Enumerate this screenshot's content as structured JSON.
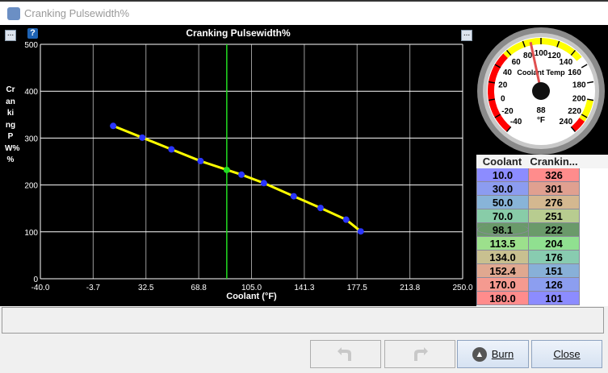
{
  "window": {
    "title": "Cranking Pulsewidth%"
  },
  "toolbar": {
    "menu_left": "...",
    "help": "?",
    "menu_right": "..."
  },
  "chart_data": {
    "type": "line",
    "title": "Cranking Pulsewidth%",
    "xlabel": "Coolant (°F)",
    "ylabel": "Cranking PW% %",
    "xlim": [
      -40,
      250
    ],
    "ylim": [
      0,
      500
    ],
    "xticks": [
      "-40.0",
      "-3.7",
      "32.5",
      "68.8",
      "105.0",
      "141.3",
      "177.5",
      "213.8",
      "250.0"
    ],
    "yticks": [
      "0",
      "100",
      "200",
      "300",
      "400",
      "500"
    ],
    "x": [
      10.0,
      30.0,
      50.0,
      70.0,
      98.1,
      113.5,
      134.0,
      152.4,
      170.0,
      180.0
    ],
    "y": [
      326,
      301,
      276,
      251,
      222,
      204,
      176,
      151,
      126,
      101
    ],
    "current_point": {
      "x": 88,
      "y": 232
    },
    "line_color": "#ffff00",
    "point_color": "#2a35ff",
    "current_color": "#22dd22",
    "grid": true
  },
  "gauge": {
    "title": "Coolant Temp",
    "value": "88",
    "unit": "°F",
    "min": -40,
    "max": 240,
    "needle": 88,
    "labels": [
      "-40",
      "-20",
      "0",
      "20",
      "40",
      "60",
      "80",
      "100",
      "120",
      "140",
      "160",
      "180",
      "200",
      "220",
      "240"
    ]
  },
  "table": {
    "headers": [
      "Coolant",
      "Crankin..."
    ],
    "rows": [
      [
        "10.0",
        "326"
      ],
      [
        "30.0",
        "301"
      ],
      [
        "50.0",
        "276"
      ],
      [
        "70.0",
        "251"
      ],
      [
        "98.1",
        "222"
      ],
      [
        "113.5",
        "204"
      ],
      [
        "134.0",
        "176"
      ],
      [
        "152.4",
        "151"
      ],
      [
        "170.0",
        "126"
      ],
      [
        "180.0",
        "101"
      ]
    ],
    "colors_left": [
      "#8c8cff",
      "#8c9cf0",
      "#88b4d8",
      "#88cca8",
      "#6a9a6a",
      "#9ce08c",
      "#c8c090",
      "#e0a890",
      "#f59a90",
      "#ff8c8c"
    ],
    "colors_right": [
      "#ff8c8c",
      "#e0a090",
      "#d4b890",
      "#b8cc90",
      "#6a9a6a",
      "#90e090",
      "#88ccb0",
      "#88b0d8",
      "#8c9ef0",
      "#8c8cff"
    ],
    "selected_row": 4
  },
  "buttons": {
    "undo": "undo",
    "redo": "redo",
    "burn": "Burn",
    "close": "Close"
  }
}
